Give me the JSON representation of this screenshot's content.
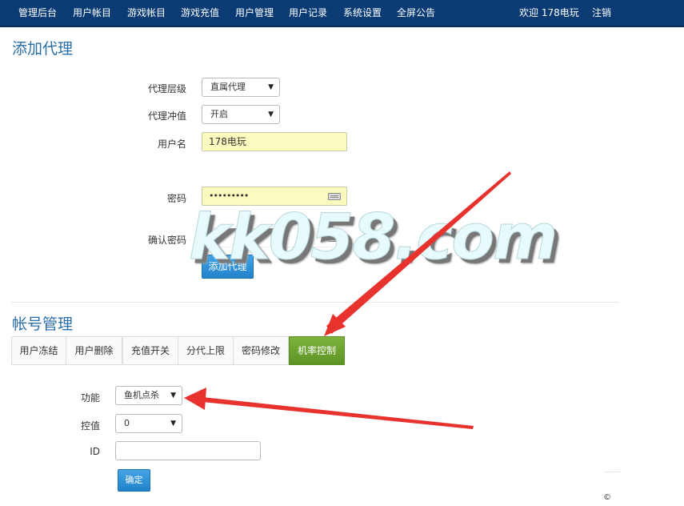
{
  "nav": {
    "items": [
      "管理后台",
      "用户帐目",
      "游戏帐目",
      "游戏充值",
      "用户管理",
      "用户记录",
      "系统设置",
      "全屏公告"
    ],
    "welcome": "欢迎 178电玩",
    "logout": "注销"
  },
  "add_agent": {
    "title": "添加代理",
    "level_label": "代理层级",
    "level_value": "直属代理",
    "recharge_label": "代理冲值",
    "recharge_value": "开启",
    "username_label": "用户名",
    "username_value": "178电玩",
    "password_label": "密码",
    "password_value": "•••••••••",
    "confirm_label": "确认密码",
    "submit_label": "添加代理"
  },
  "account": {
    "title": "帐号管理",
    "tabs": [
      "用户冻结",
      "用户删除",
      "充值开关",
      "分代上限",
      "密码修改",
      "机率控制"
    ],
    "active_tab": "机率控制",
    "function_label": "功能",
    "function_value": "鱼机点杀",
    "control_label": "控值",
    "control_value": "0",
    "id_label": "ID",
    "confirm_label": "确定"
  },
  "watermark": "kk058.com",
  "footer": {
    "copyright": "©"
  },
  "colors": {
    "nav_bg": "#0a3b74",
    "title": "#2a6ea8",
    "active_tab": "#6aa131",
    "button": "#2d8fd8",
    "arrow": "#e8322d"
  }
}
